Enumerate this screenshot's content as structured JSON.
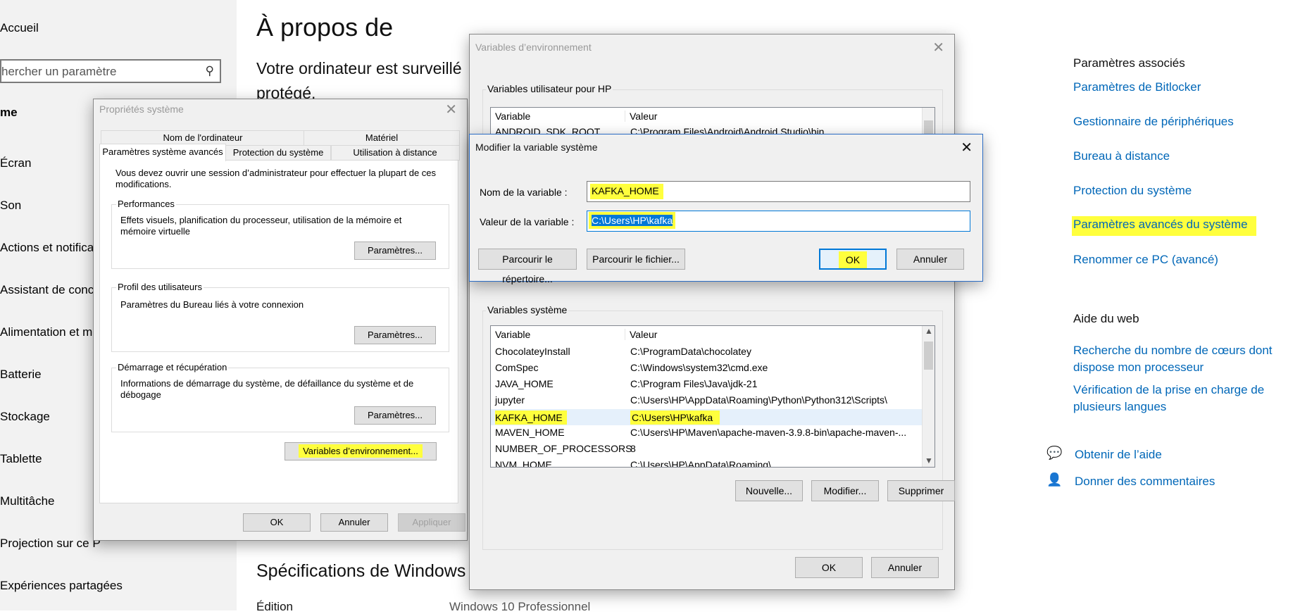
{
  "sidebar": {
    "home": "Accueil",
    "search_placeholder": "hercher un paramètre",
    "section": "me",
    "items": [
      "Écran",
      "Son",
      "Actions et notificat",
      "Assistant de conce",
      "Alimentation et mi",
      "Batterie",
      "Stockage",
      "Tablette",
      "Multitâche",
      "Projection sur ce P",
      "Expériences partagées"
    ]
  },
  "main": {
    "title": "À propos de",
    "text_line1": "Votre ordinateur est surveillé",
    "text_line2": "protégé.",
    "specs_title": "Spécifications de Windows",
    "edition_label": "Édition",
    "edition_value": "Windows 10 Professionnel"
  },
  "right_panel": {
    "related_heading": "Paramètres associés",
    "related_links": [
      "Paramètres de Bitlocker",
      "Gestionnaire de périphériques",
      "Bureau à distance",
      "Protection du système",
      "Paramètres avancés du système",
      "Renommer ce PC (avancé)"
    ],
    "web_help_heading": "Aide du web",
    "web_link1_l1": "Recherche du nombre de cœurs dont",
    "web_link1_l2": "dispose mon processeur",
    "web_link2_l1": "Vérification de la prise en charge de",
    "web_link2_l2": "plusieurs langues",
    "get_help": "Obtenir de l’aide",
    "feedback": "Donner des commentaires"
  },
  "sys_props": {
    "title": "Propriétés système",
    "tabs_row1": [
      "Nom de l'ordinateur",
      "Matériel"
    ],
    "tabs_row2": [
      "Paramètres système avancés",
      "Protection du système",
      "Utilisation à distance"
    ],
    "admin_note": "Vous devez ouvrir une session d’administrateur pour effectuer la plupart de ces modifications.",
    "perf_label": "Performances",
    "perf_text": "Effets visuels, planification du processeur, utilisation de la mémoire et mémoire virtuelle",
    "profile_label": "Profil des utilisateurs",
    "profile_text": "Paramètres du Bureau liés à votre connexion",
    "startup_label": "Démarrage et récupération",
    "startup_text": "Informations de démarrage du système, de défaillance du système et de débogage",
    "settings_btn": "Paramètres...",
    "env_btn": "Variables d’environnement...",
    "ok": "OK",
    "cancel": "Annuler",
    "apply": "Appliquer"
  },
  "env_vars": {
    "title": "Variables d’environnement",
    "user_group": "Variables utilisateur pour HP",
    "col_variable": "Variable",
    "col_value": "Valeur",
    "user_rows": [
      {
        "name": "ANDROID_SDK_ROOT",
        "value": "C:\\Program Files\\Android\\Android Studio\\bin"
      }
    ],
    "system_group": "Variables système",
    "system_rows": [
      {
        "name": "ChocolateyInstall",
        "value": "C:\\ProgramData\\chocolatey"
      },
      {
        "name": "ComSpec",
        "value": "C:\\Windows\\system32\\cmd.exe"
      },
      {
        "name": "JAVA_HOME",
        "value": "C:\\Program Files\\Java\\jdk-21"
      },
      {
        "name": "jupyter",
        "value": "C:\\Users\\HP\\AppData\\Roaming\\Python\\Python312\\Scripts\\"
      },
      {
        "name": "KAFKA_HOME",
        "value": "C:\\Users\\HP\\kafka"
      },
      {
        "name": "MAVEN_HOME",
        "value": "C:\\Users\\HP\\Maven\\apache-maven-3.9.8-bin\\apache-maven-..."
      },
      {
        "name": "NUMBER_OF_PROCESSORS",
        "value": "8"
      },
      {
        "name": "NVM_HOME",
        "value": "C:\\Users\\HP\\AppData\\Roaming\\"
      }
    ],
    "new_btn": "Nouvelle...",
    "edit_btn": "Modifier...",
    "delete_btn": "Supprimer",
    "ok": "OK",
    "cancel": "Annuler"
  },
  "edit_var": {
    "title": "Modifier la variable système",
    "name_label": "Nom de la variable :",
    "name_value": "KAFKA_HOME",
    "value_label": "Valeur de la variable :",
    "value_value": "C:\\Users\\HP\\kafka",
    "browse_dir": "Parcourir le répertoire...",
    "browse_file": "Parcourir le fichier...",
    "ok": "OK",
    "cancel": "Annuler"
  },
  "colors": {
    "highlight": "#ffff3d",
    "link": "#0067b8",
    "selection": "#0078d7"
  }
}
